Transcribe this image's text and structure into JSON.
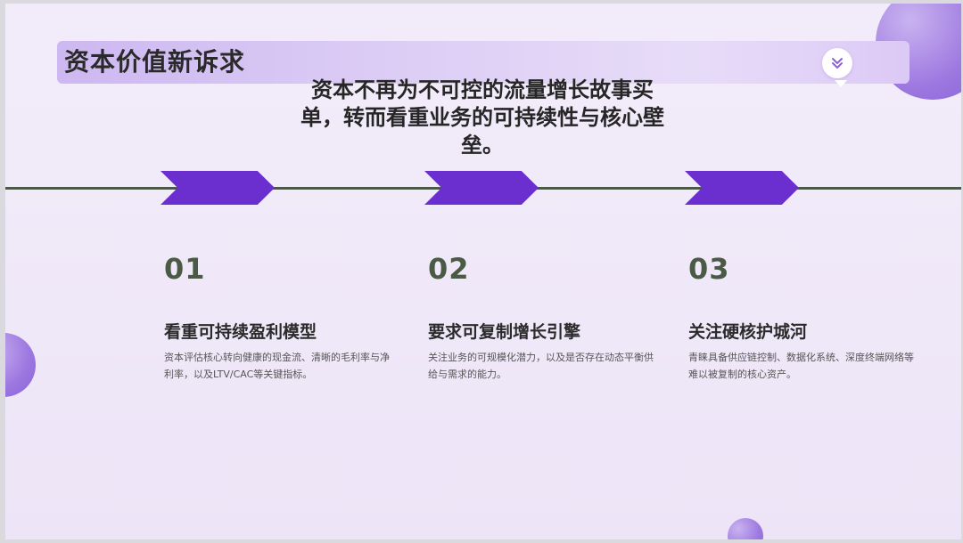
{
  "slide": {
    "title": "资本价值新诉求",
    "subtitle": "资本不再为不可控的流量增长故事买单，转而看重业务的可持续性与核心壁垒。",
    "accent_color": "#6c2fcf",
    "number_color": "#4a5a44",
    "icon": "double-chevron-down-icon"
  },
  "columns": [
    {
      "number": "01",
      "heading": "看重可持续盈利模型",
      "description": "资本评估核心转向健康的现金流、清晰的毛利率与净利率，以及LTV/CAC等关键指标。"
    },
    {
      "number": "02",
      "heading": "要求可复制增长引擎",
      "description": "关注业务的可规模化潜力，以及是否存在动态平衡供给与需求的能力。"
    },
    {
      "number": "03",
      "heading": "关注硬核护城河",
      "description": "青睐具备供应链控制、数据化系统、深度终端网络等难以被复制的核心资产。"
    }
  ]
}
